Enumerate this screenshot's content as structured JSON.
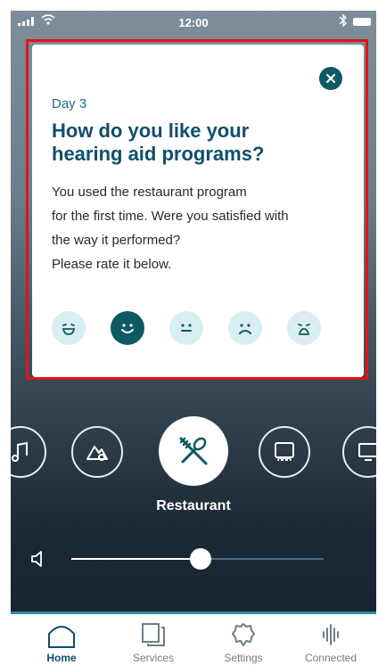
{
  "status_bar": {
    "time": "12:00"
  },
  "dialog": {
    "day_label": "Day 3",
    "title": "How do you like your hearing aid programs?",
    "body_lines": [
      "You used the restaurant program",
      "for the first time. Were you satisfied with",
      "the way it performed?",
      "Please rate it below."
    ],
    "ratings": [
      {
        "icon": "very-happy-face-icon",
        "selected": false
      },
      {
        "icon": "happy-face-icon",
        "selected": true
      },
      {
        "icon": "neutral-face-icon",
        "selected": false
      },
      {
        "icon": "sad-face-icon",
        "selected": false
      },
      {
        "icon": "very-sad-face-icon",
        "selected": false
      }
    ]
  },
  "programs": {
    "items": [
      "music-icon",
      "nature-icon",
      "restaurant-icon",
      "theater-icon",
      "tv-icon"
    ],
    "selected_label": "Restaurant"
  },
  "volume": {
    "level": 0.52
  },
  "tabs": [
    {
      "label": "Home",
      "icon": "home-icon",
      "active": true
    },
    {
      "label": "Services",
      "icon": "services-icon",
      "active": false
    },
    {
      "label": "Settings",
      "icon": "settings-icon",
      "active": false
    },
    {
      "label": "Connected",
      "icon": "connected-icon",
      "active": false
    }
  ],
  "colors": {
    "accent": "#0d5a63",
    "title": "#0f4e6e",
    "highlight_border": "#e3121c"
  }
}
